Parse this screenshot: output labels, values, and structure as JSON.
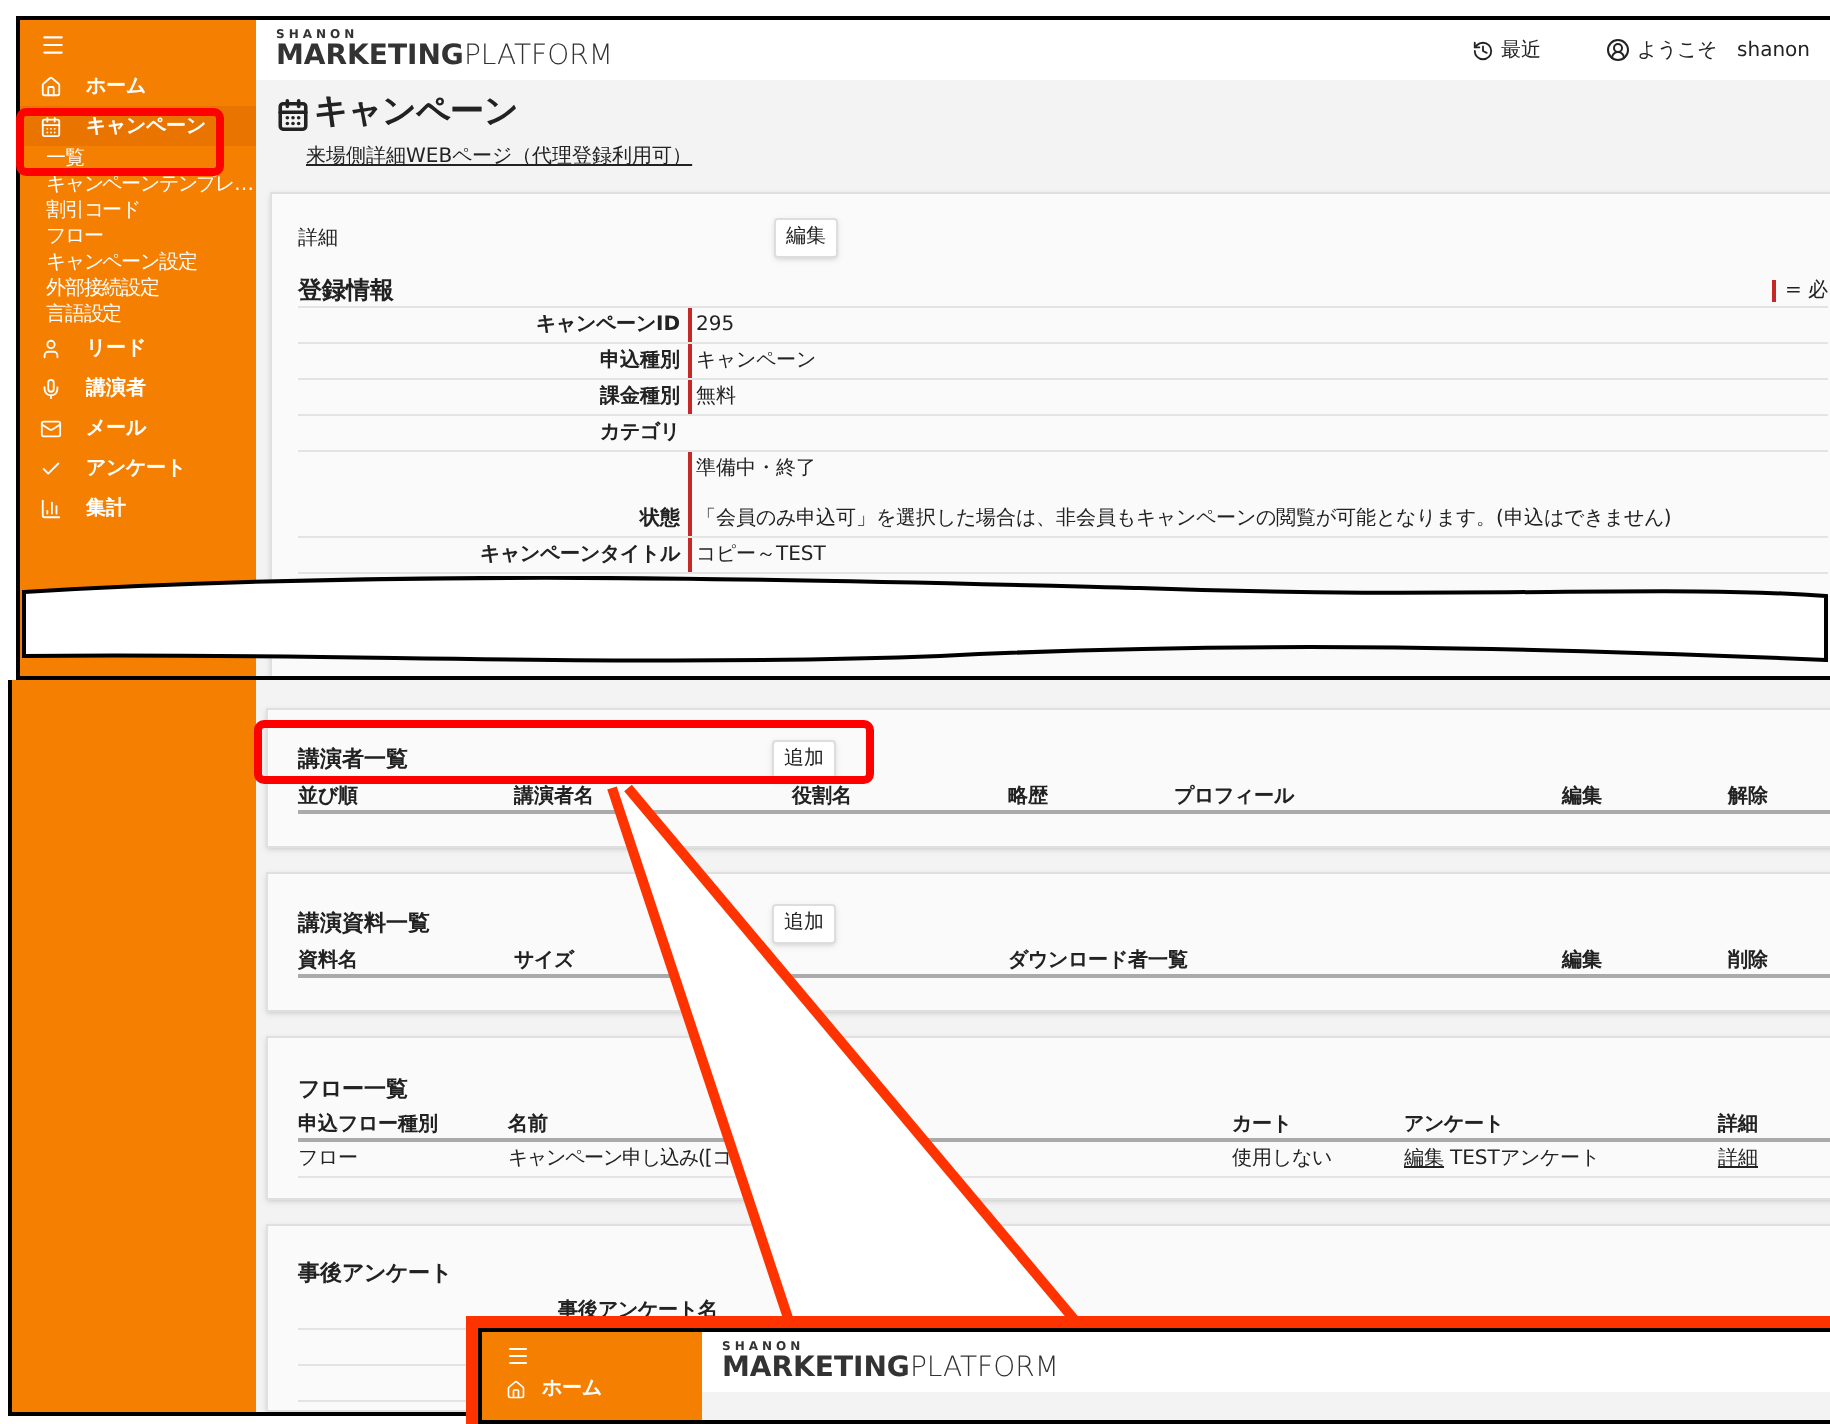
{
  "screen": {
    "sidebar": {
      "items": [
        {
          "label": "ホーム",
          "expanded": false
        },
        {
          "label": "キャンペーン",
          "expanded": true,
          "children": [
            {
              "label": "一覧"
            },
            {
              "label": "キャンペーンテンプレ…"
            },
            {
              "label": "割引コード"
            },
            {
              "label": "フロー"
            },
            {
              "label": "キャンペーン設定"
            },
            {
              "label": "外部接続設定"
            },
            {
              "label": "言語設定"
            }
          ]
        },
        {
          "label": "リード",
          "expanded": false
        },
        {
          "label": "講演者",
          "expanded": false
        },
        {
          "label": "メール",
          "expanded": false
        },
        {
          "label": "アンケート",
          "expanded": false
        },
        {
          "label": "集計",
          "expanded": false
        }
      ]
    },
    "header": {
      "logo": {
        "top": "SHANON",
        "bold": "MARKETING",
        "light": "PLATFORM"
      },
      "recent": "最近",
      "welcome": "ようこそ",
      "user": "shanon"
    },
    "page_title": "キャンペーン",
    "link": "来場側詳細WEBページ（代理登録利用可）",
    "details": {
      "caption": "詳細",
      "edit_button": "編集",
      "heading": "登録情報",
      "required_legend": "= 必",
      "rows": [
        {
          "label": "キャンペーンID",
          "values": [
            "295"
          ],
          "required": true
        },
        {
          "label": "申込種別",
          "values": [
            "キャンペーン"
          ],
          "required": true
        },
        {
          "label": "課金種別",
          "values": [
            "無料"
          ],
          "required": true
        },
        {
          "label": "カテゴリ",
          "values": [],
          "required": false
        },
        {
          "label": "状態",
          "values": [
            "準備中・終了",
            "「会員のみ申込可」を選択した場合は、非会員もキャンペーンの閲覧が可能となります。(申込はできません)"
          ],
          "required": true
        },
        {
          "label": "キャンペーンタイトル",
          "values": [
            "コピー～TEST"
          ],
          "required": true
        }
      ]
    }
  },
  "continued": {
    "speakers": {
      "title": "講演者一覧",
      "add_button": "追加",
      "columns": [
        "並び順",
        "講演者名",
        "役割名",
        "略歴",
        "プロフィール",
        "編集",
        "解除"
      ]
    },
    "materials": {
      "title": "講演資料一覧",
      "add_button": "追加",
      "columns": [
        "資料名",
        "サイズ",
        "ダウンロード者一覧",
        "編集",
        "削除"
      ]
    },
    "flows": {
      "title": "フロー一覧",
      "columns": [
        "申込フロー種別",
        "名前",
        "カート",
        "アンケート",
        "詳細"
      ],
      "rows": [
        {
          "cells": [
            {
              "text": "フロー"
            },
            {
              "text": "キャンペーン申し込み([コ"
            },
            {
              "text": "使用しない"
            },
            {
              "link": "編集",
              "text": "TESTアンケート"
            },
            {
              "link": "詳細"
            }
          ]
        }
      ]
    },
    "post_survey": {
      "title": "事後アンケート",
      "column": "事後アンケート名"
    }
  },
  "inset": {
    "sidebar": {
      "items": [
        {
          "label": "ホーム"
        }
      ]
    },
    "header": {
      "logo": {
        "top": "SHANON",
        "bold": "MARKETING",
        "light": "PLATFORM"
      }
    }
  }
}
